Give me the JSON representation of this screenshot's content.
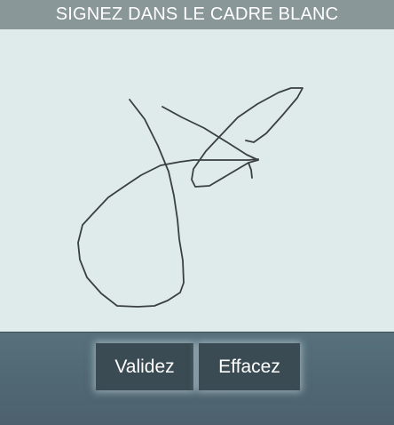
{
  "header": {
    "title": "SIGNEZ DANS LE CADRE BLANC"
  },
  "signature_pad": {
    "background_color": "#dfeaea",
    "stroke_color": "#3a3f42"
  },
  "buttons": {
    "validate_label": "Validez",
    "clear_label": "Effacez"
  }
}
